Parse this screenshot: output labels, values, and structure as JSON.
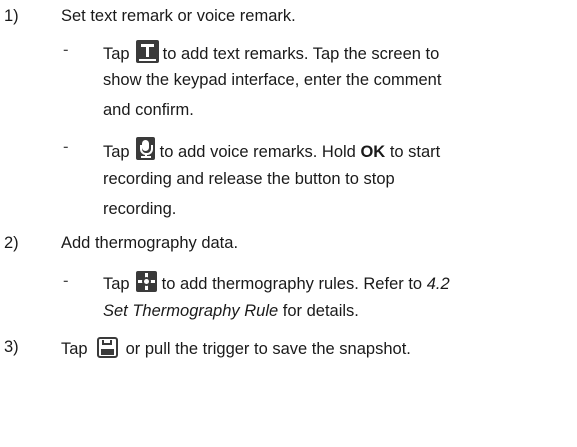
{
  "steps": [
    {
      "number": "1)",
      "text": "Set text remark or voice remark.",
      "bullets": [
        {
          "dash": "-",
          "prefix": "Tap",
          "icon": "text-t-icon",
          "line1_suffix": "to add text remarks. Tap the screen to",
          "line2": "show the keypad interface, enter the comment",
          "line3": "and confirm."
        },
        {
          "dash": "-",
          "prefix": "Tap",
          "icon": "microphone-icon",
          "line1_mid": "to add voice remarks. Hold",
          "line1_bold": "OK",
          "line1_end": "to start",
          "line2": "recording and release the button to stop",
          "line3": "recording."
        }
      ]
    },
    {
      "number": "2)",
      "text": "Add thermography data.",
      "bullets": [
        {
          "dash": "-",
          "prefix": "Tap",
          "icon": "thermography-rule-icon",
          "line1_mid": "to add thermography rules. Refer to",
          "line1_italic": "4.2",
          "line2_italic": "Set Thermography Rule",
          "line2_end": "for details."
        }
      ]
    },
    {
      "number": "3)",
      "prefix": "Tap",
      "icon": "save-icon",
      "text": "or pull the trigger to save the snapshot."
    }
  ]
}
